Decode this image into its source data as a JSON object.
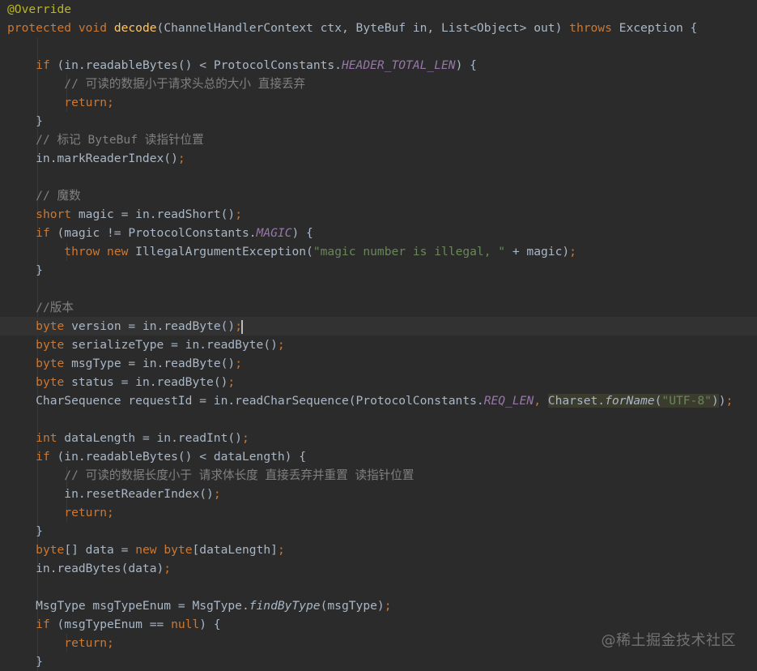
{
  "editor": {
    "colors": {
      "background": "#2b2b2b",
      "keyword": "#cc7832",
      "annotation": "#bbb529",
      "method_declaration": "#ffc66d",
      "constant_field": "#9876aa",
      "string": "#6a8759",
      "comment": "#808080",
      "default_text": "#a9b7c6"
    },
    "current_line": 17,
    "lines": [
      [
        [
          "an",
          "@Override"
        ]
      ],
      [
        [
          "kw",
          "protected"
        ],
        [
          "",
          " "
        ],
        [
          "kw",
          "void"
        ],
        [
          "",
          " "
        ],
        [
          "fn",
          "decode"
        ],
        [
          "",
          "(ChannelHandlerContext ctx, ByteBuf in, List<Object> out) "
        ],
        [
          "kw",
          "throws"
        ],
        [
          "",
          " Exception {"
        ]
      ],
      [],
      [
        [
          "",
          "    "
        ],
        [
          "kw",
          "if"
        ],
        [
          "",
          " (in.readableBytes() < ProtocolConstants."
        ],
        [
          "cf",
          "HEADER_TOTAL_LEN"
        ],
        [
          "",
          ") {"
        ]
      ],
      [
        [
          "",
          "        "
        ],
        [
          "cm",
          "// 可读的数据小于请求头总的大小 直接丢弃"
        ]
      ],
      [
        [
          "",
          "        "
        ],
        [
          "kw",
          "return"
        ],
        [
          "kw",
          ";"
        ]
      ],
      [
        [
          "",
          "    }"
        ]
      ],
      [
        [
          "",
          "    "
        ],
        [
          "cm",
          "// 标记 ByteBuf 读指针位置"
        ]
      ],
      [
        [
          "",
          "    in.markReaderIndex()"
        ],
        [
          "kw",
          ";"
        ]
      ],
      [],
      [
        [
          "",
          "    "
        ],
        [
          "cm",
          "// 魔数"
        ]
      ],
      [
        [
          "",
          "    "
        ],
        [
          "kw",
          "short"
        ],
        [
          "",
          " magic = in.readShort()"
        ],
        [
          "kw",
          ";"
        ]
      ],
      [
        [
          "",
          "    "
        ],
        [
          "kw",
          "if"
        ],
        [
          "",
          " (magic != ProtocolConstants."
        ],
        [
          "cf",
          "MAGIC"
        ],
        [
          "",
          ") {"
        ]
      ],
      [
        [
          "",
          "        "
        ],
        [
          "kw",
          "throw"
        ],
        [
          "",
          " "
        ],
        [
          "kw",
          "new"
        ],
        [
          "",
          " IllegalArgumentException("
        ],
        [
          "st",
          "\"magic number is illegal, \""
        ],
        [
          "",
          " + magic)"
        ],
        [
          "kw",
          ";"
        ]
      ],
      [
        [
          "",
          "    }"
        ]
      ],
      [],
      [
        [
          "",
          "    "
        ],
        [
          "cm",
          "//版本"
        ]
      ],
      [
        [
          "",
          "    "
        ],
        [
          "kw",
          "byte"
        ],
        [
          "",
          " version = in.readByte()"
        ],
        [
          "kw",
          ";"
        ],
        [
          "caret",
          ""
        ]
      ],
      [
        [
          "",
          "    "
        ],
        [
          "kw",
          "byte"
        ],
        [
          "",
          " serializeType = in.readByte()"
        ],
        [
          "kw",
          ";"
        ]
      ],
      [
        [
          "",
          "    "
        ],
        [
          "kw",
          "byte"
        ],
        [
          "",
          " msgType = in.readByte()"
        ],
        [
          "kw",
          ";"
        ]
      ],
      [
        [
          "",
          "    "
        ],
        [
          "kw",
          "byte"
        ],
        [
          "",
          " status = in.readByte()"
        ],
        [
          "kw",
          ";"
        ]
      ],
      [
        [
          "",
          "    CharSequence requestId = in.readCharSequence(ProtocolConstants."
        ],
        [
          "cf",
          "REQ_LEN"
        ],
        [
          "kw",
          ","
        ],
        [
          "",
          " "
        ],
        [
          "hl",
          "Charset."
        ],
        [
          "hl-sm",
          "forName"
        ],
        [
          "hl",
          "("
        ],
        [
          "hl-st",
          "\"UTF-8\""
        ],
        [
          "hl",
          ")"
        ],
        [
          "",
          ")"
        ],
        [
          "kw",
          ";"
        ]
      ],
      [],
      [
        [
          "",
          "    "
        ],
        [
          "kw",
          "int"
        ],
        [
          "",
          " dataLength = in.readInt()"
        ],
        [
          "kw",
          ";"
        ]
      ],
      [
        [
          "",
          "    "
        ],
        [
          "kw",
          "if"
        ],
        [
          "",
          " (in.readableBytes() < dataLength) {"
        ]
      ],
      [
        [
          "",
          "        "
        ],
        [
          "cm",
          "// 可读的数据长度小于 请求体长度 直接丢弃并重置 读指针位置"
        ]
      ],
      [
        [
          "",
          "        in.resetReaderIndex()"
        ],
        [
          "kw",
          ";"
        ]
      ],
      [
        [
          "",
          "        "
        ],
        [
          "kw",
          "return"
        ],
        [
          "kw",
          ";"
        ]
      ],
      [
        [
          "",
          "    }"
        ]
      ],
      [
        [
          "",
          "    "
        ],
        [
          "kw",
          "byte"
        ],
        [
          "",
          "[] data = "
        ],
        [
          "kw",
          "new"
        ],
        [
          "",
          " "
        ],
        [
          "kw",
          "byte"
        ],
        [
          "",
          "[dataLength]"
        ],
        [
          "kw",
          ";"
        ]
      ],
      [
        [
          "",
          "    in.readBytes(data)"
        ],
        [
          "kw",
          ";"
        ]
      ],
      [],
      [
        [
          "",
          "    MsgType msgTypeEnum = MsgType."
        ],
        [
          "sm",
          "findByType"
        ],
        [
          "",
          "(msgType)"
        ],
        [
          "kw",
          ";"
        ]
      ],
      [
        [
          "",
          "    "
        ],
        [
          "kw",
          "if"
        ],
        [
          "",
          " (msgTypeEnum == "
        ],
        [
          "kw",
          "null"
        ],
        [
          "",
          ") {"
        ]
      ],
      [
        [
          "",
          "        "
        ],
        [
          "kw",
          "return"
        ],
        [
          "kw",
          ";"
        ]
      ],
      [
        [
          "",
          "    }"
        ]
      ]
    ]
  },
  "watermark": {
    "text": "@稀土掘金技术社区"
  }
}
